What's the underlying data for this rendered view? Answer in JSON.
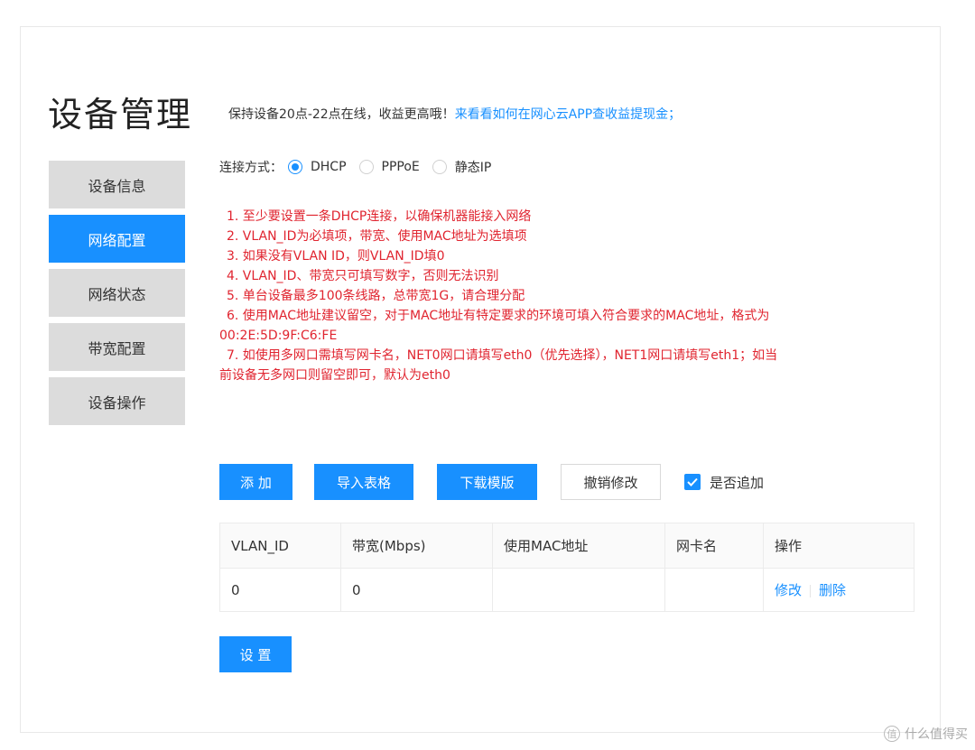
{
  "page": {
    "title": "设备管理"
  },
  "sidebar": {
    "items": [
      {
        "label": "设备信息",
        "active": false
      },
      {
        "label": "网络配置",
        "active": true
      },
      {
        "label": "网络状态",
        "active": false
      },
      {
        "label": "带宽配置",
        "active": false
      },
      {
        "label": "设备操作",
        "active": false
      }
    ]
  },
  "notice": {
    "text": "保持设备20点-22点在线，收益更高哦！",
    "link": "来看看如何在网心云APP查收益提现金；"
  },
  "connection": {
    "label": "连接方式：",
    "options": [
      {
        "label": "DHCP",
        "checked": true
      },
      {
        "label": "PPPoE",
        "checked": false
      },
      {
        "label": "静态IP",
        "checked": false
      }
    ]
  },
  "rules": [
    {
      "text": "1. 至少要设置一条DHCP连接，以确保机器能接入网络"
    },
    {
      "text": "2. VLAN_ID为必填项，带宽、使用MAC地址为选填项"
    },
    {
      "text": "3. 如果没有VLAN ID，则VLAN_ID填0"
    },
    {
      "text": "4. VLAN_ID、带宽只可填写数字，否则无法识别"
    },
    {
      "text": "5. 单台设备最多100条线路，总带宽1G，请合理分配"
    },
    {
      "text": "6. 使用MAC地址建议留空，对于MAC地址有特定要求的环境可填入符合要求的MAC地址，格式为",
      "cont": "00:2E:5D:9F:C6:FE"
    },
    {
      "text": "7. 如使用多网口需填写网卡名，NET0网口请填写eth0（优先选择），NET1网口请填写eth1；如当",
      "cont": "前设备无多网口则留空即可，默认为eth0"
    }
  ],
  "actions": {
    "add": "添 加",
    "import": "导入表格",
    "download": "下载模版",
    "revoke": "撤销修改",
    "append": {
      "label": "是否追加",
      "checked": true
    }
  },
  "table": {
    "headers": [
      "VLAN_ID",
      "带宽(Mbps)",
      "使用MAC地址",
      "网卡名",
      "操作"
    ],
    "rows": [
      {
        "vlan_id": "0",
        "bandwidth": "0",
        "mac": "",
        "nic": "",
        "edit": "修改",
        "delete": "删除"
      }
    ]
  },
  "submit": "设 置",
  "watermark": {
    "logo": "值",
    "text": "什么值得买"
  },
  "colors": {
    "accent": "#1890ff",
    "warning": "#e0242f",
    "inactive": "#dcdcdc"
  }
}
